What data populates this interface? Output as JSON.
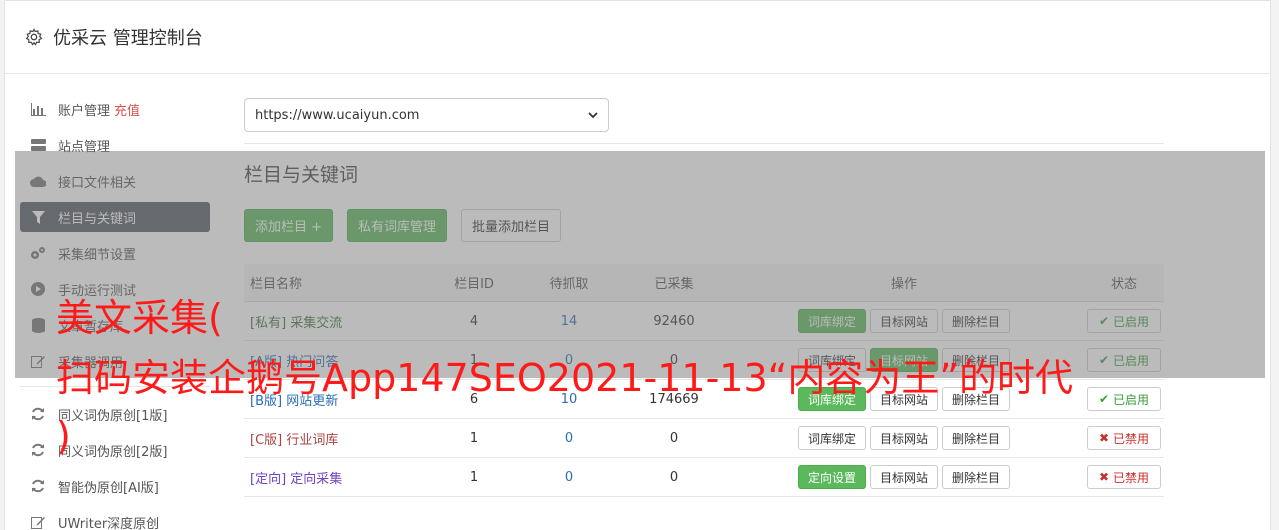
{
  "header": {
    "title": "优采云 管理控制台"
  },
  "sidebar": {
    "items": [
      {
        "label": "账户管理",
        "extra": "充值",
        "icon": "bar-chart-icon"
      },
      {
        "label": "站点管理",
        "icon": "server-icon"
      },
      {
        "label": "接口文件相关",
        "icon": "cloud-upload-icon"
      },
      {
        "label": "栏目与关键词",
        "icon": "filter-icon",
        "active": true
      },
      {
        "label": "采集细节设置",
        "icon": "cogs-icon"
      },
      {
        "label": "手动运行测试",
        "icon": "play-icon"
      },
      {
        "label": "文章暂存库",
        "icon": "database-icon"
      },
      {
        "label": "采集器调用",
        "icon": "edit-icon"
      }
    ],
    "items2": [
      {
        "label": "同义词伪原创[1版]",
        "icon": "refresh-icon"
      },
      {
        "label": "同义词伪原创[2版]",
        "icon": "refresh-icon"
      },
      {
        "label": "智能伪原创[AI版]",
        "icon": "refresh-icon"
      },
      {
        "label": "UWriter深度原创",
        "icon": "edit-icon"
      }
    ]
  },
  "site_select": {
    "value": "https://www.ucaiyun.com"
  },
  "section": {
    "title": "栏目与关键词",
    "buttons": {
      "add": "添加栏目 +",
      "private_lib": "私有词库管理",
      "batch_add": "批量添加栏目"
    }
  },
  "table": {
    "headers": [
      "栏目名称",
      "栏目ID",
      "待抓取",
      "已采集",
      "操作",
      "状态"
    ],
    "rows": [
      {
        "tag": "[私有]",
        "name": "采集交流",
        "id": "4",
        "pending": "14",
        "collected": "92460",
        "op1": "词库绑定",
        "op2": "目标网站",
        "op3": "删除栏目",
        "status": "已启用"
      },
      {
        "tag": "[A版]",
        "name": "热门问答",
        "id": "1",
        "pending": "0",
        "collected": "0",
        "op1": "词库绑定",
        "op2": "目标网站",
        "op3": "删除栏目",
        "status": "已启用"
      },
      {
        "tag": "[B版]",
        "name": "网站更新",
        "id": "6",
        "pending": "10",
        "collected": "174669",
        "op1": "词库绑定",
        "op2": "目标网站",
        "op3": "删除栏目",
        "status": "已启用"
      },
      {
        "tag": "[C版]",
        "name": "行业词库",
        "id": "1",
        "pending": "0",
        "collected": "0",
        "op1": "词库绑定",
        "op2": "目标网站",
        "op3": "删除栏目",
        "status": "已禁用"
      },
      {
        "tag": "[定向]",
        "name": "定向采集",
        "id": "1",
        "pending": "0",
        "collected": "0",
        "op1": "定向设置",
        "op2": "目标网站",
        "op3": "删除栏目",
        "status": "已禁用"
      }
    ]
  },
  "watermark": {
    "line1": "美文采集(",
    "line2": "扫码安装企鹅号App147SEO2021-11-13“内容为王”的时代",
    "line3": ")"
  }
}
